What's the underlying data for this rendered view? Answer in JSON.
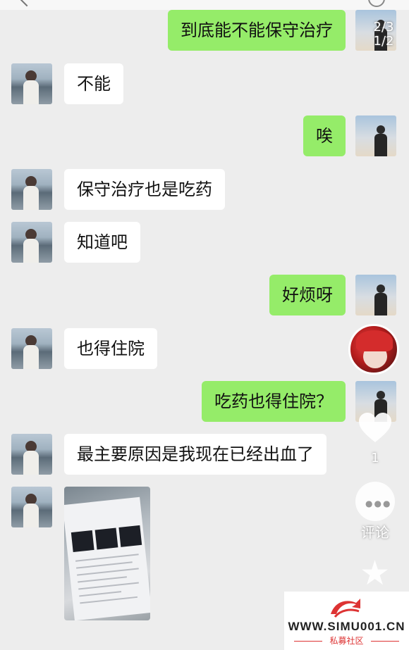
{
  "messages": [
    {
      "side": "right",
      "text": "到底能不能保守治疗"
    },
    {
      "side": "left",
      "text": "不能"
    },
    {
      "side": "right",
      "text": "唉"
    },
    {
      "side": "left",
      "text": "保守治疗也是吃药"
    },
    {
      "side": "left",
      "text": "知道吧"
    },
    {
      "side": "right",
      "text": "好烦呀"
    },
    {
      "side": "left",
      "text": "也得住院"
    },
    {
      "side": "right",
      "text": "吃药也得住院？"
    },
    {
      "side": "left",
      "text": "最主要原因是我现在已经出血了"
    },
    {
      "side": "left",
      "type": "image",
      "text": ""
    }
  ],
  "page_counter": {
    "line1": "2/3",
    "line2": "1/2"
  },
  "side_actions": {
    "like_count": "1",
    "comment_label": "评论"
  },
  "watermark": {
    "url": "WWW.SIMU001.CN",
    "subtitle": "私募社区"
  },
  "colors": {
    "background": "#ededed",
    "outgoing_bubble": "#95ec69",
    "incoming_bubble": "#ffffff",
    "watermark_accent": "#dd3333"
  },
  "icons": [
    "back-arrow-icon",
    "search-icon",
    "heart-icon",
    "comment-icon",
    "star-icon"
  ]
}
